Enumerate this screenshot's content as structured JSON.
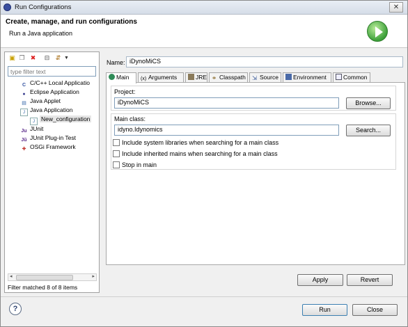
{
  "window": {
    "title": "Run Configurations",
    "close_glyph": "✕"
  },
  "banner": {
    "heading": "Create, manage, and run configurations",
    "subheading": "Run a Java application",
    "icon": "run-icon"
  },
  "left": {
    "filter_placeholder": "type filter text",
    "tree": [
      {
        "label": "C/C++ Local Applicatio",
        "icon": "c-icon",
        "glyph": "C"
      },
      {
        "label": "Eclipse Application",
        "icon": "eclipse-icon",
        "glyph": "●"
      },
      {
        "label": "Java Applet",
        "icon": "applet-icon",
        "glyph": "▤"
      },
      {
        "label": "Java Application",
        "icon": "java-app-icon",
        "glyph": "J"
      },
      {
        "label": "New_configuration",
        "icon": "java-app-icon",
        "glyph": "J"
      },
      {
        "label": "JUnit",
        "icon": "junit-icon",
        "glyph": "Ju"
      },
      {
        "label": "JUnit Plug-in Test",
        "icon": "junit-plugin-icon",
        "glyph": "Jŭ"
      },
      {
        "label": "OSGi Framework",
        "icon": "osgi-icon",
        "glyph": "✚"
      }
    ],
    "status": "Filter matched 8 of 8 items"
  },
  "config": {
    "name_label": "Name:",
    "name_value": "iDynoMiCS",
    "tabs": [
      {
        "label": "Main",
        "icon": "main-tab-icon"
      },
      {
        "label": "Arguments",
        "icon": "arguments-tab-icon"
      },
      {
        "label": "JRE",
        "icon": "jre-tab-icon"
      },
      {
        "label": "Classpath",
        "icon": "classpath-tab-icon"
      },
      {
        "label": "Source",
        "icon": "source-tab-icon"
      },
      {
        "label": "Environment",
        "icon": "environment-tab-icon"
      },
      {
        "label": "Common",
        "icon": "common-tab-icon"
      }
    ],
    "project_label": "Project:",
    "project_value": "iDynoMiCS",
    "browse_label": "Browse...",
    "main_class_label": "Main class:",
    "main_class_value": "idyno.Idynomics",
    "search_label": "Search...",
    "checkboxes": [
      {
        "label": "Include system libraries when searching for a main class",
        "checked": false
      },
      {
        "label": "Include inherited mains when searching for a main class",
        "checked": false
      },
      {
        "label": "Stop in main",
        "checked": false
      }
    ],
    "apply_label": "Apply",
    "revert_label": "Revert"
  },
  "footer": {
    "help_glyph": "?",
    "run_label": "Run",
    "close_label": "Close"
  },
  "colors": {
    "accent_green": "#3da03a",
    "selection": "#e6e6e6"
  }
}
